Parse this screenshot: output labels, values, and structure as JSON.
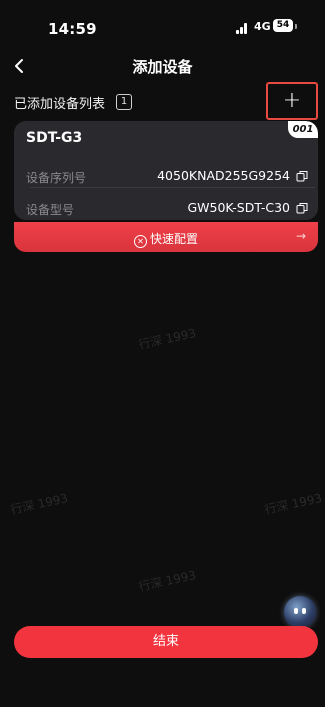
{
  "status_bar": {
    "time": "14:59",
    "network": "4G",
    "battery": "54"
  },
  "nav": {
    "title": "添加设备"
  },
  "list_header": {
    "title": "已添加设备列表",
    "count": "1"
  },
  "device": {
    "name": "SDT-G3",
    "index": "001",
    "serial_label": "设备序列号",
    "serial_value": "4050KNAD255G9254",
    "model_label": "设备型号",
    "model_value": "GW50K-SDT-C30",
    "quick_config": "快速配置"
  },
  "watermark": "行深 1993",
  "footer": {
    "finish_label": "结束"
  },
  "colors": {
    "accent": "#f2343f",
    "card": "#2a2a2e",
    "background": "#0e0e0e"
  }
}
